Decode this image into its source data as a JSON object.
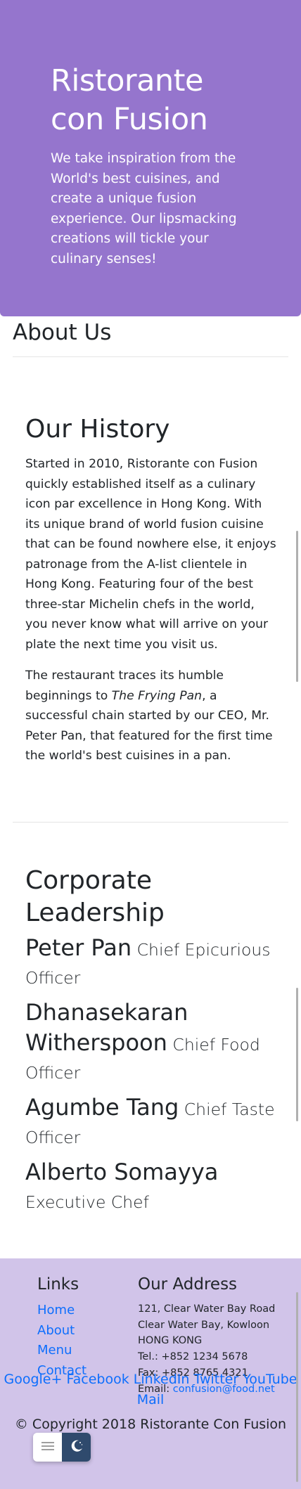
{
  "jumbotron": {
    "title_line1": "Ristorante",
    "title_line2": "con Fusion",
    "tagline": "We take inspiration from the World's best cuisines, and create a unique fusion experience. Our lipsmacking creations will tickle your culinary senses!"
  },
  "about": {
    "title": "About Us"
  },
  "history": {
    "title": "Our History",
    "paragraph1": "Started in 2010, Ristorante con Fusion quickly established itself as a culinary icon par excellence in Hong Kong. With its unique brand of world fusion cuisine that can be found nowhere else, it enjoys patronage from the A-list clientele in Hong Kong. Featuring four of the best three-star Michelin chefs in the world, you never know what will arrive on your plate the next time you visit us.",
    "paragraph2_before": "The restaurant traces its humble beginnings to ",
    "paragraph2_em": "The Frying Pan",
    "paragraph2_after": ", a successful chain started by our CEO, Mr. Peter Pan, that featured for the first time the world's best cuisines in a pan."
  },
  "leadership": {
    "title": "Corporate Leadership",
    "leaders": [
      {
        "name": "Peter Pan",
        "role": "Chief Epicurious Officer"
      },
      {
        "name": "Dhanasekaran Witherspoon",
        "role": "Chief Food Officer"
      },
      {
        "name": "Agumbe Tang",
        "role": "Chief Taste Officer"
      },
      {
        "name": "Alberto Somayya",
        "role": "Executive Chef"
      }
    ]
  },
  "footer": {
    "links_title": "Links",
    "links": [
      "Home",
      "About",
      "Menu",
      "Contact"
    ],
    "address_title": "Our Address",
    "address_lines": [
      "121, Clear Water Bay Road",
      "Clear Water Bay, Kowloon",
      "HONG KONG",
      "Tel.: +852 1234 5678",
      "Fax: +852 8765 4321"
    ],
    "email_label": "Email: ",
    "email": "confusion@food.net",
    "social": [
      "Google+",
      "Facebook",
      "LinkedIn",
      "Twitter",
      "YouTube",
      "Mail"
    ],
    "copyright": "© Copyright 2018 Ristorante Con Fusion"
  },
  "colors": {
    "jumbotron_bg": "#9575cd",
    "footer_bg": "#d1c4e9",
    "link": "#0d6efd",
    "dark_mode_button": "#2f4a6d"
  },
  "icons": [
    "menu-icon",
    "moon-icon"
  ]
}
